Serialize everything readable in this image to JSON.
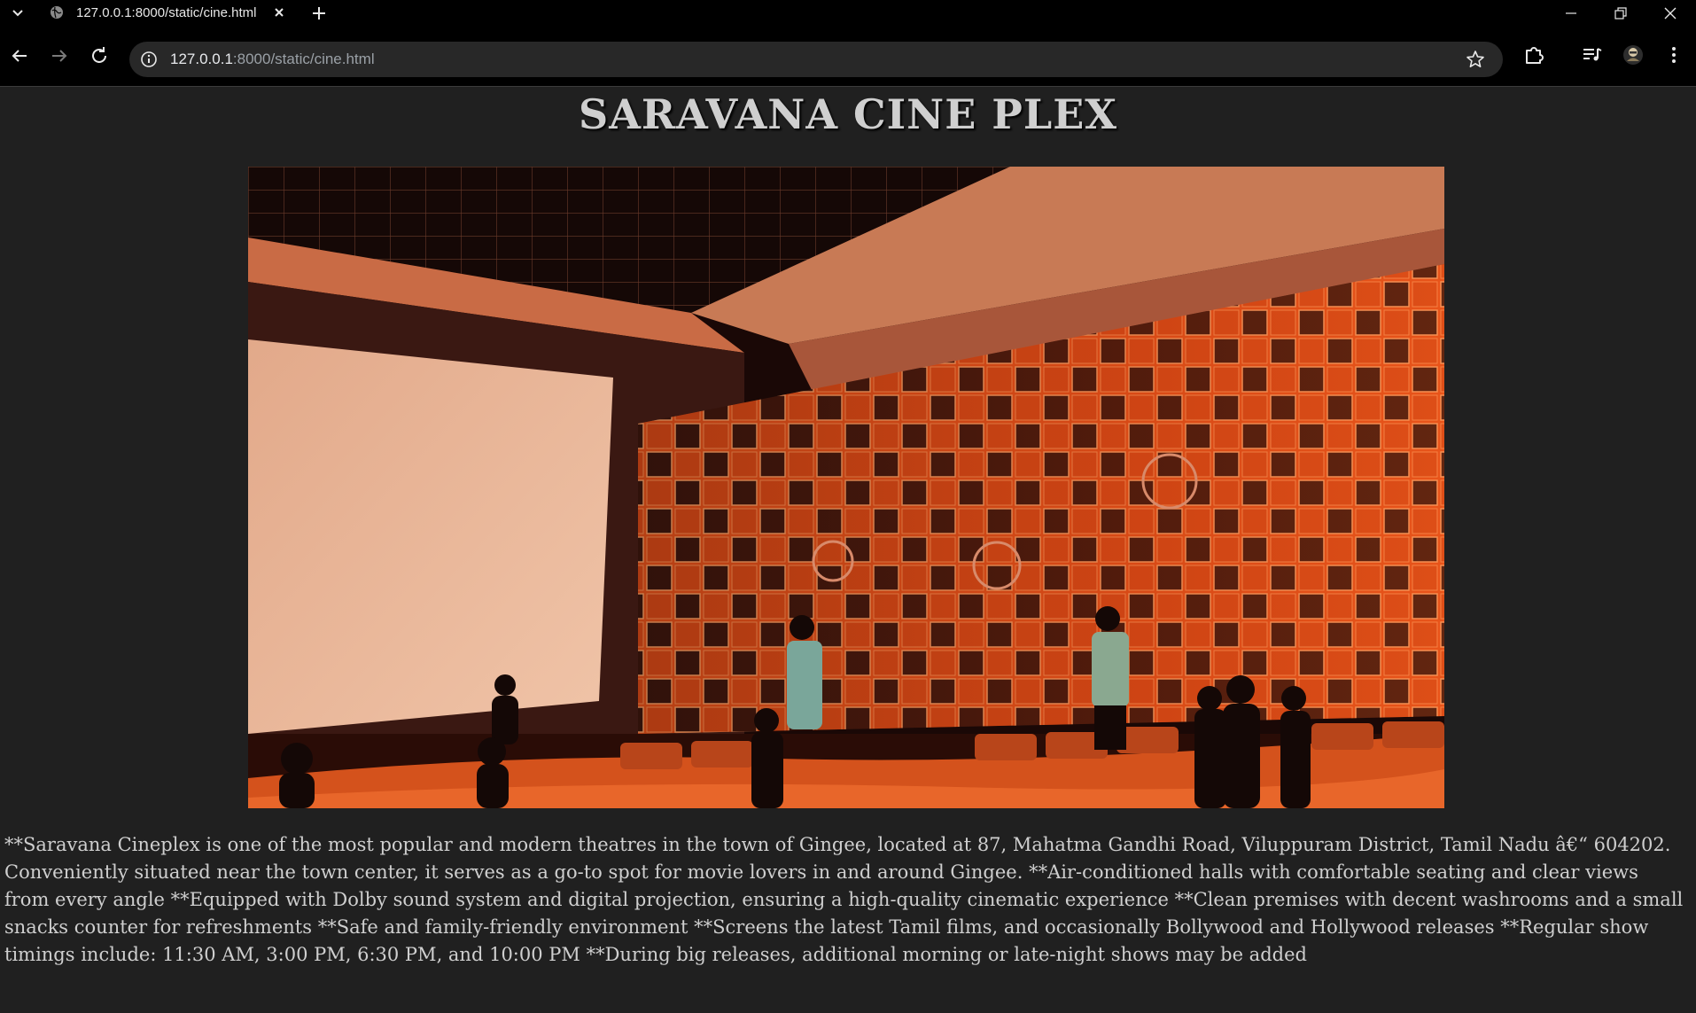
{
  "browser": {
    "tab_title": "127.0.0.1:8000/static/cine.html",
    "url_host": "127.0.0.1",
    "url_path": ":8000/static/cine.html",
    "icons": {
      "tab_menu": "chevron-down-icon",
      "favicon": "globe-icon",
      "tab_close": "close-icon",
      "new_tab": "plus-icon",
      "minimize": "minimize-icon",
      "restore": "restore-icon",
      "close_window": "close-icon",
      "back": "arrow-left-icon",
      "forward": "arrow-right-icon",
      "reload": "reload-icon",
      "site_info": "info-icon",
      "bookmark": "star-icon",
      "extensions": "puzzle-icon",
      "media": "media-queue-icon",
      "profile": "avatar-icon",
      "menu": "kebab-menu-icon"
    }
  },
  "page": {
    "heading": "SARAVANA CINE PLEX",
    "image_description_icon": "theatre-photo",
    "description": "**Saravana Cineplex is one of the most popular and modern theatres in the town of Gingee, located at 87, Mahatma Gandhi Road, Viluppuram District, Tamil Nadu â€“ 604202. Conveniently situated near the town center, it serves as a go-to spot for movie lovers in and around Gingee. **Air-conditioned halls with comfortable seating and clear views from every angle **Equipped with Dolby sound system and digital projection, ensuring a high-quality cinematic experience **Clean premises with decent washrooms and a small snacks counter for refreshments **Safe and family-friendly environment **Screens the latest Tamil films, and occasionally Bollywood and Hollywood releases **Regular show timings include: 11:30 AM, 3:00 PM, 6:30 PM, and 10:00 PM **During big releases, additional morning or late-night shows may be added"
  },
  "colors": {
    "page_background": "#202020",
    "text": "#cfcfcf",
    "chrome_background": "#000000",
    "accent_orange": "#e8541a"
  }
}
